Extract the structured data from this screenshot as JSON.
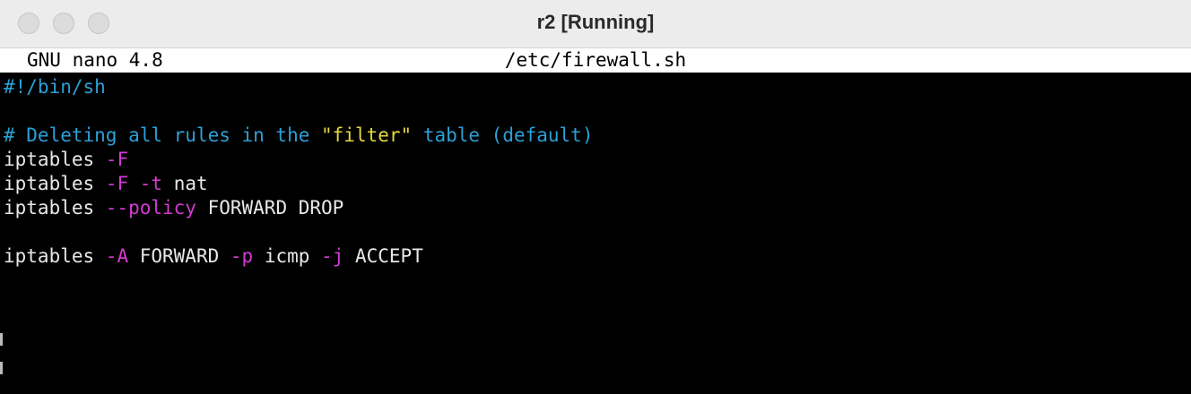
{
  "window": {
    "title": "r2 [Running]"
  },
  "nano": {
    "version": "GNU nano 4.8",
    "filename": "/etc/firewall.sh"
  },
  "editor": {
    "line1": {
      "shebang": "#!/bin/sh"
    },
    "line3": {
      "comment_a": "# Deleting all rules in the ",
      "string": "\"filter\"",
      "comment_b": " table (default)"
    },
    "line4": {
      "cmd": "iptables ",
      "flag": "-F"
    },
    "line5": {
      "cmd": "iptables ",
      "flag1": "-F",
      "space": " ",
      "flag2": "-t",
      "arg": " nat"
    },
    "line6": {
      "cmd": "iptables ",
      "flag": "--policy",
      "arg": " FORWARD DROP"
    },
    "line8": {
      "cmd": "iptables ",
      "flag1": "-A",
      "arg1": " FORWARD ",
      "flag2": "-p",
      "arg2": " icmp ",
      "flag3": "-j",
      "arg3": " ACCEPT"
    }
  },
  "colors": {
    "comment": "#2c9fd6",
    "string": "#e7d83c",
    "flag": "#d23bd2",
    "text": "#e8e8e8",
    "background": "#000000"
  }
}
